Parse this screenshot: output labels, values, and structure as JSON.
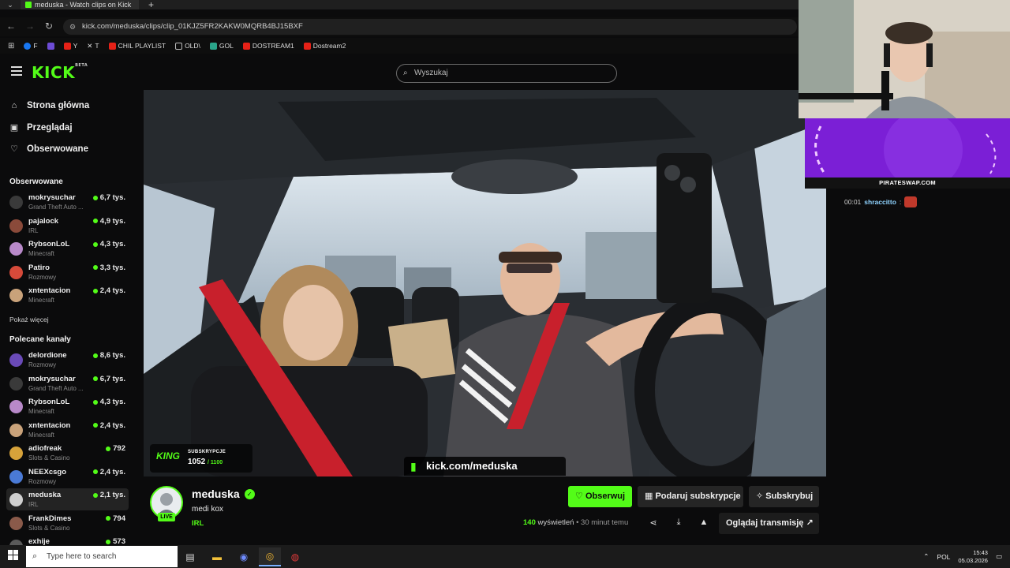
{
  "browser": {
    "tab_title": "meduska - Watch clips on Kick",
    "url": "kick.com/meduska/clips/clip_01KJZ5FR2KAKW0MQRB4BJ15BXF",
    "bookmarks": [
      {
        "label": "F",
        "color": "#1877f2"
      },
      {
        "label": "",
        "color": "#6d4cd6"
      },
      {
        "label": "Y",
        "color": "#e62117"
      },
      {
        "label": "T",
        "color": "#ffffff"
      },
      {
        "label": "CHIL PLAYLIST",
        "color": "#e62117"
      },
      {
        "label": "OLD\\",
        "color": "#888888"
      },
      {
        "label": "GOL",
        "color": "#2aa58a"
      },
      {
        "label": "DOSTREAM1",
        "color": "#e62117"
      },
      {
        "label": "Dostream2",
        "color": "#e62117"
      }
    ]
  },
  "header": {
    "logo": "KICK",
    "logo_badge": "BETA",
    "search_placeholder": "Wyszukaj"
  },
  "sidebar": {
    "nav": [
      {
        "label": "Strona główna",
        "icon": "home-icon",
        "glyph": "⌂"
      },
      {
        "label": "Przeglądaj",
        "icon": "browse-icon",
        "glyph": "▣"
      },
      {
        "label": "Obserwowane",
        "icon": "heart-icon",
        "glyph": "♡"
      }
    ],
    "followed_title": "Obserwowane",
    "followed": [
      {
        "name": "mokrysuchar",
        "category": "Grand Theft Auto ...",
        "viewers": "6,7 tys.",
        "color": "#3a3a3a"
      },
      {
        "name": "pajalock",
        "category": "IRL",
        "viewers": "4,9 tys.",
        "color": "#8a4a3a"
      },
      {
        "name": "RybsonLoL",
        "category": "Minecraft",
        "viewers": "4,3 tys.",
        "color": "#b889c9"
      },
      {
        "name": "Patiro",
        "category": "Rozmowy",
        "viewers": "3,3 tys.",
        "color": "#d64a3a"
      },
      {
        "name": "xntentacion",
        "category": "Minecraft",
        "viewers": "2,4 tys.",
        "color": "#c9a27a"
      }
    ],
    "show_more": "Pokaż więcej",
    "recommended_title": "Polecane kanały",
    "recommended": [
      {
        "name": "delordione",
        "category": "Rozmowy",
        "viewers": "8,6 tys.",
        "color": "#6a4ab8"
      },
      {
        "name": "mokrysuchar",
        "category": "Grand Theft Auto ...",
        "viewers": "6,7 tys.",
        "color": "#3a3a3a"
      },
      {
        "name": "RybsonLoL",
        "category": "Minecraft",
        "viewers": "4,3 tys.",
        "color": "#b889c9"
      },
      {
        "name": "xntentacion",
        "category": "Minecraft",
        "viewers": "2,4 tys.",
        "color": "#c9a27a"
      },
      {
        "name": "adiofreak",
        "category": "Slots & Casino",
        "viewers": "792",
        "color": "#d6a23a"
      },
      {
        "name": "NEEXcsgo",
        "category": "Rozmowy",
        "viewers": "2,4 tys.",
        "color": "#4a7ad6"
      },
      {
        "name": "meduska",
        "category": "IRL",
        "viewers": "2,1 tys.",
        "color": "#cfcfcf"
      },
      {
        "name": "FrankDimes",
        "category": "Slots & Casino",
        "viewers": "794",
        "color": "#8a5a4a"
      },
      {
        "name": "exhije",
        "category": "",
        "viewers": "573",
        "color": "#5a5a5a"
      }
    ]
  },
  "video": {
    "subs_label": "SUBSKRYPCJE",
    "subs_current": "1052",
    "subs_goal": "/ 1100",
    "subs_logo": "KING",
    "banner_url": "kick.com/meduska"
  },
  "overlay": {
    "promo_footer": "PIRATESWAP.COM",
    "chat": {
      "time": "00:01",
      "user": "shraccitto",
      "sep": ":"
    }
  },
  "channel": {
    "name": "meduska",
    "clip_title": "medi kox",
    "category": "IRL",
    "live": "LIVE",
    "follow": "Obserwuj",
    "gift": "Podaruj subskrypcje",
    "subscribe": "Subskrybuj",
    "views_count": "140",
    "views_label": "wyświetleń",
    "time_ago": "• 30 minut temu",
    "watch_stream": "Oglądaj transmisję"
  },
  "taskbar": {
    "search_placeholder": "Type here to search",
    "lang": "POL",
    "time": "15:43",
    "date": "05.03.2026"
  }
}
